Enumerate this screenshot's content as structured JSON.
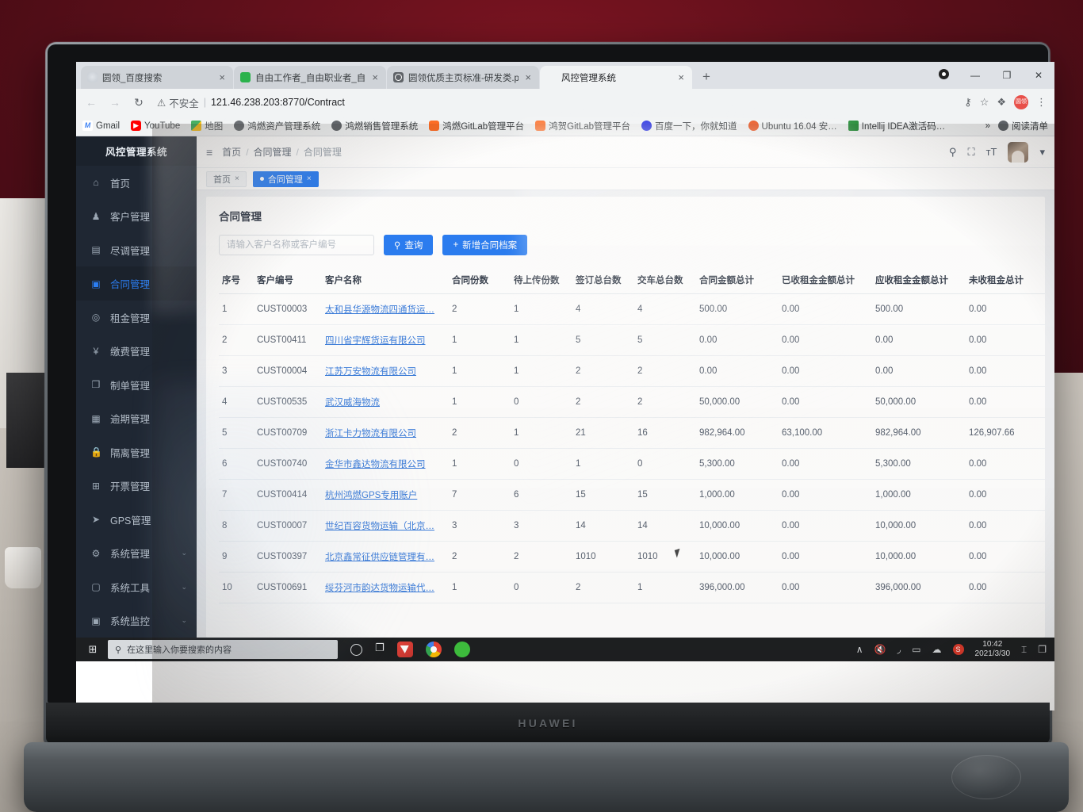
{
  "browser": {
    "tabs": [
      {
        "title": "圆领_百度搜索",
        "icon": "baidu-favicon",
        "active": false,
        "close": "×"
      },
      {
        "title": "自由工作者_自由职业者_自由工…",
        "icon": "green-favicon",
        "active": false,
        "close": "×"
      },
      {
        "title": "圆领优质主页标准-研发类.pdf",
        "icon": "globe-favicon",
        "active": false,
        "close": "×"
      },
      {
        "title": "风控管理系统",
        "icon": "blank-favicon",
        "active": true,
        "close": "×"
      }
    ],
    "new_tab_label": "+",
    "window_controls": {
      "minimize": "—",
      "maximize": "❐",
      "close": "✕"
    },
    "toolbar": {
      "back": "←",
      "forward": "→",
      "reload": "↻",
      "security_label": "不安全",
      "security_icon": "⚠",
      "url": "121.46.238.203:8770/Contract",
      "key_icon": "⚷",
      "star_icon": "☆",
      "extensions_icon": "❖",
      "profile_initial": "圆领",
      "menu_icon": "⋮"
    },
    "bookmarks": [
      {
        "label": "Gmail",
        "icon": "gmail-icon"
      },
      {
        "label": "YouTube",
        "icon": "youtube-icon"
      },
      {
        "label": "地图",
        "icon": "maps-icon"
      },
      {
        "label": "鸿燃资产管理系统",
        "icon": "globe-icon"
      },
      {
        "label": "鸿燃销售管理系统",
        "icon": "globe-icon"
      },
      {
        "label": "鸿燃GitLab管理平台",
        "icon": "gitlab-icon"
      },
      {
        "label": "鸿贺GitLab管理平台",
        "icon": "gitlab-icon"
      },
      {
        "label": "百度一下，你就知道",
        "icon": "baidu-icon"
      },
      {
        "label": "Ubuntu 16.04 安…",
        "icon": "ubuntu-icon"
      },
      {
        "label": "Intellij IDEA激活码…",
        "icon": "idea-icon"
      }
    ],
    "bookmarks_overflow": "»",
    "reading_list": "阅读清单",
    "reading_list_icon": "reading-list-icon"
  },
  "sidebar": {
    "brand": "风控管理系统",
    "items": [
      {
        "label": "首页",
        "icon": "home-icon",
        "active": false,
        "expandable": false
      },
      {
        "label": "客户管理",
        "icon": "users-icon",
        "active": false,
        "expandable": false
      },
      {
        "label": "尽调管理",
        "icon": "clipboard-icon",
        "active": false,
        "expandable": false
      },
      {
        "label": "合同管理",
        "icon": "document-icon",
        "active": true,
        "expandable": false
      },
      {
        "label": "租金管理",
        "icon": "circle-icon",
        "active": false,
        "expandable": false
      },
      {
        "label": "缴费管理",
        "icon": "yuan-icon",
        "active": false,
        "expandable": false
      },
      {
        "label": "制单管理",
        "icon": "copy-icon",
        "active": false,
        "expandable": false
      },
      {
        "label": "逾期管理",
        "icon": "calendar-icon",
        "active": false,
        "expandable": false
      },
      {
        "label": "隔离管理",
        "icon": "lock-icon",
        "active": false,
        "expandable": false
      },
      {
        "label": "开票管理",
        "icon": "grid-icon",
        "active": false,
        "expandable": false
      },
      {
        "label": "GPS管理",
        "icon": "send-icon",
        "active": false,
        "expandable": false
      },
      {
        "label": "系统管理",
        "icon": "gear-icon",
        "active": false,
        "expandable": true
      },
      {
        "label": "系统工具",
        "icon": "toolbox-icon",
        "active": false,
        "expandable": true
      },
      {
        "label": "系统监控",
        "icon": "monitor-icon",
        "active": false,
        "expandable": true
      }
    ],
    "caret": "⌄"
  },
  "topbar": {
    "menu_icon": "≡",
    "breadcrumb": [
      "首页",
      "合同管理",
      "合同管理"
    ],
    "separator": "/",
    "search_icon": "⚲",
    "fullscreen_icon": "⛶",
    "fontsize_icon": "ᴛT",
    "avatar": "user-avatar",
    "avatar_caret": "▾"
  },
  "tabchips": [
    {
      "label": "首页",
      "active": false,
      "close": "×"
    },
    {
      "label": "合同管理",
      "active": true,
      "close": "×"
    }
  ],
  "panel": {
    "title": "合同管理",
    "search_placeholder": "请输入客户名称或客户编号",
    "search_value": "",
    "query_button": "查询",
    "query_icon": "⚲",
    "add_button": "新增合同档案",
    "add_icon": "+"
  },
  "table": {
    "columns": [
      "序号",
      "客户编号",
      "客户名称",
      "合同份数",
      "待上传份数",
      "签订总台数",
      "交车总台数",
      "合同金额总计",
      "已收租金金额总计",
      "应收租金金额总计",
      "未收租金总计"
    ],
    "rows": [
      {
        "seq": "1",
        "code": "CUST00003",
        "name": "太和县华源物流四通货运…",
        "contracts": "2",
        "pending": "1",
        "signed": "4",
        "delivered": "4",
        "amount": "500.00",
        "received": "0.00",
        "receivable": "500.00",
        "unreceived": "0.00"
      },
      {
        "seq": "2",
        "code": "CUST00411",
        "name": "四川省宇辉货运有限公司",
        "contracts": "1",
        "pending": "1",
        "signed": "5",
        "delivered": "5",
        "amount": "0.00",
        "received": "0.00",
        "receivable": "0.00",
        "unreceived": "0.00"
      },
      {
        "seq": "3",
        "code": "CUST00004",
        "name": "江苏万安物流有限公司",
        "contracts": "1",
        "pending": "1",
        "signed": "2",
        "delivered": "2",
        "amount": "0.00",
        "received": "0.00",
        "receivable": "0.00",
        "unreceived": "0.00"
      },
      {
        "seq": "4",
        "code": "CUST00535",
        "name": "武汉威海物流",
        "contracts": "1",
        "pending": "0",
        "signed": "2",
        "delivered": "2",
        "amount": "50,000.00",
        "received": "0.00",
        "receivable": "50,000.00",
        "unreceived": "0.00"
      },
      {
        "seq": "5",
        "code": "CUST00709",
        "name": "浙江卡力物流有限公司",
        "contracts": "2",
        "pending": "1",
        "signed": "21",
        "delivered": "16",
        "amount": "982,964.00",
        "received": "63,100.00",
        "receivable": "982,964.00",
        "unreceived": "126,907.66"
      },
      {
        "seq": "6",
        "code": "CUST00740",
        "name": "金华市鑫达物流有限公司",
        "contracts": "1",
        "pending": "0",
        "signed": "1",
        "delivered": "0",
        "amount": "5,300.00",
        "received": "0.00",
        "receivable": "5,300.00",
        "unreceived": "0.00"
      },
      {
        "seq": "7",
        "code": "CUST00414",
        "name": "杭州鸿燃GPS专用账户",
        "contracts": "7",
        "pending": "6",
        "signed": "15",
        "delivered": "15",
        "amount": "1,000.00",
        "received": "0.00",
        "receivable": "1,000.00",
        "unreceived": "0.00"
      },
      {
        "seq": "8",
        "code": "CUST00007",
        "name": "世纪百容货物运输（北京…",
        "contracts": "3",
        "pending": "3",
        "signed": "14",
        "delivered": "14",
        "amount": "10,000.00",
        "received": "0.00",
        "receivable": "10,000.00",
        "unreceived": "0.00"
      },
      {
        "seq": "9",
        "code": "CUST00397",
        "name": "北京鑫常征供应链管理有…",
        "contracts": "2",
        "pending": "2",
        "signed": "1010",
        "delivered": "1010",
        "amount": "10,000.00",
        "received": "0.00",
        "receivable": "10,000.00",
        "unreceived": "0.00"
      },
      {
        "seq": "10",
        "code": "CUST00691",
        "name": "绥芬河市韵达货物运输代…",
        "contracts": "1",
        "pending": "0",
        "signed": "2",
        "delivered": "1",
        "amount": "396,000.00",
        "received": "0.00",
        "receivable": "396,000.00",
        "unreceived": "0.00"
      }
    ]
  },
  "taskbar": {
    "start_icon": "windows-icon",
    "search_placeholder": "在这里输入你要搜索的内容",
    "search_icon": "⚲",
    "apps": [
      {
        "name": "cortana-icon"
      },
      {
        "name": "task-view-icon"
      },
      {
        "name": "wps-icon"
      },
      {
        "name": "chrome-icon"
      },
      {
        "name": "wechat-icon"
      }
    ],
    "tray": {
      "chevron": "∧",
      "volume_icon": "×",
      "network_icon": "◠",
      "battery_icon": "▭",
      "onedrive_icon": "☁",
      "sogou_icon": "S",
      "time": "10:42",
      "date": "2021/3/30",
      "ime_icon": "⌶",
      "notification_icon": "❐"
    }
  },
  "laptop": {
    "brand": "HUAWEI"
  },
  "colors": {
    "accent": "#2b7ef3",
    "sidebar_bg": "#1f2733",
    "link": "#3b7ddd",
    "chrome_tabstrip": "#dee1e6"
  }
}
